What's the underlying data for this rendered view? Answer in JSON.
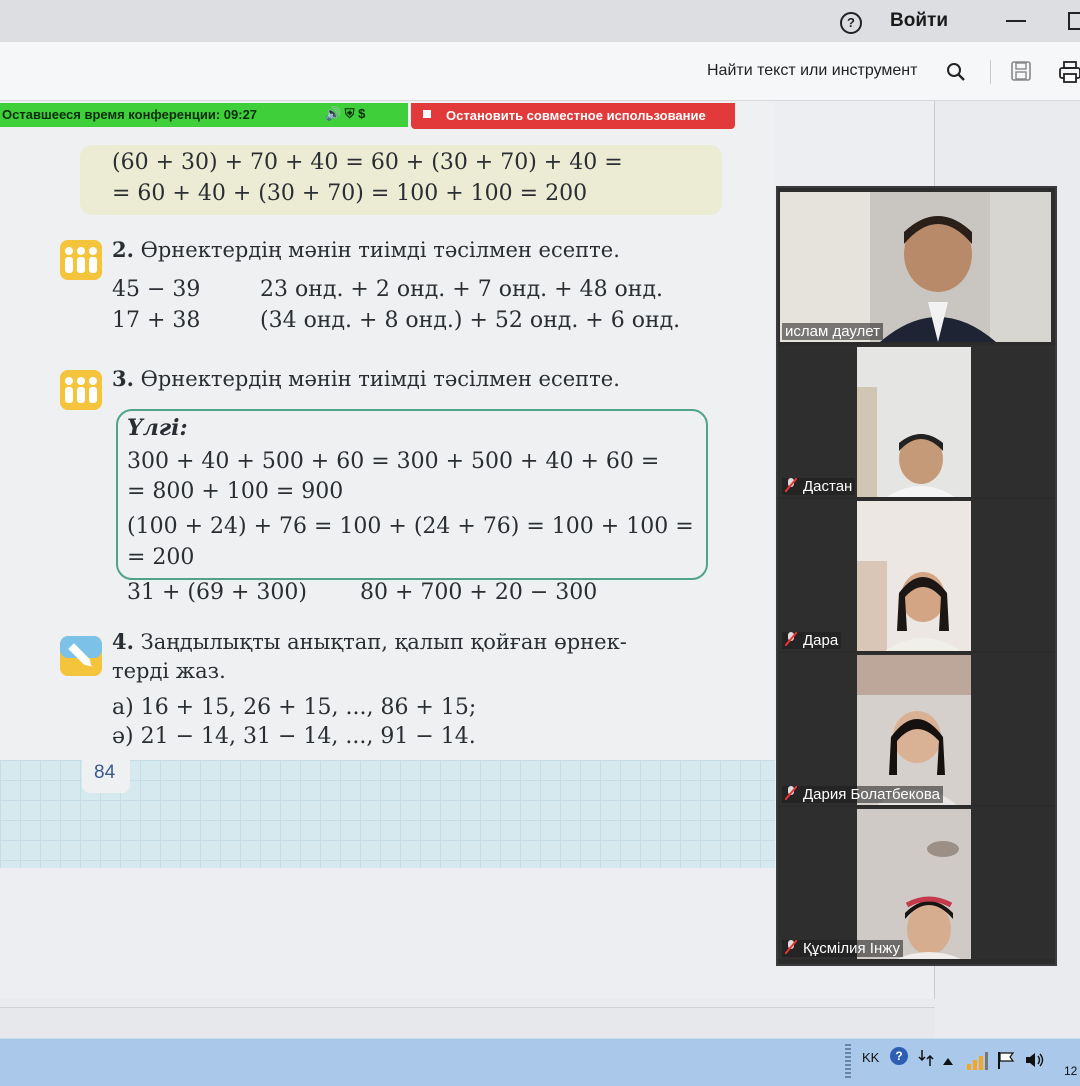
{
  "titlebar": {
    "help_icon": "?",
    "login_label": "Войти"
  },
  "toolbar": {
    "find_tool_label": "Найти текст или инструмент"
  },
  "conference": {
    "remaining_time": "Оставшееся время конференции: 09:27",
    "status_icons": "🔊 ⛨ $",
    "stop_share_label": "Остановить совместное использование"
  },
  "book": {
    "example": {
      "line1": "(60 + 30) + 70 + 40 = 60 + (30 + 70) + 40 =",
      "line2": "= 60 + 40 + (30 + 70) = 100 + 100 = 200"
    },
    "task2": {
      "number": "2.",
      "title": "Өрнектердің мәнін тиімді тәсілмен есепте.",
      "col1": [
        "45 − 39",
        "17 + 38"
      ],
      "col2": [
        "23 онд. + 2 онд. + 7 онд. + 48 онд.",
        "(34 онд. + 8 онд.) + 52 онд. + 6 онд."
      ]
    },
    "task3": {
      "number": "3.",
      "title": "Өрнектердің мәнін тиімді тәсілмен есепте.",
      "sample_label": "Үлгі:",
      "sample_lines": [
        "300 + 40 + 500 + 60 = 300 + 500 + 40 + 60 =",
        "= 800 + 100 = 900",
        "(100 + 24) + 76 = 100 + (24 + 76) = 100 + 100 =",
        "= 200"
      ],
      "exercises": [
        "31 + (69 + 300)",
        "80 + 700 + 20 − 300"
      ]
    },
    "task4": {
      "number": "4.",
      "title_line1": "Заңдылықты анықтап, қалып қойған өрнек-",
      "title_line2": "терді жаз.",
      "items": [
        "а) 16 + 15, 26 + 15, ..., 86 + 15;",
        "ә) 21 − 14, 31 − 14, ..., 91 − 14."
      ]
    },
    "page_number": "84"
  },
  "participants": [
    {
      "name": "ислам даулет",
      "muted": false
    },
    {
      "name": "Дастан",
      "muted": true
    },
    {
      "name": "Дара",
      "muted": true
    },
    {
      "name": "Дария Болатбекова",
      "muted": true
    },
    {
      "name": "Құсмілия Інжу",
      "muted": true
    }
  ],
  "taskbar": {
    "language": "KK",
    "tray_help": "?",
    "clock": "12"
  },
  "colors": {
    "conference_green": "#3ecf3a",
    "stop_red": "#e23a3a",
    "sample_border": "#4fa487",
    "task_icon": "#f4c43c"
  }
}
